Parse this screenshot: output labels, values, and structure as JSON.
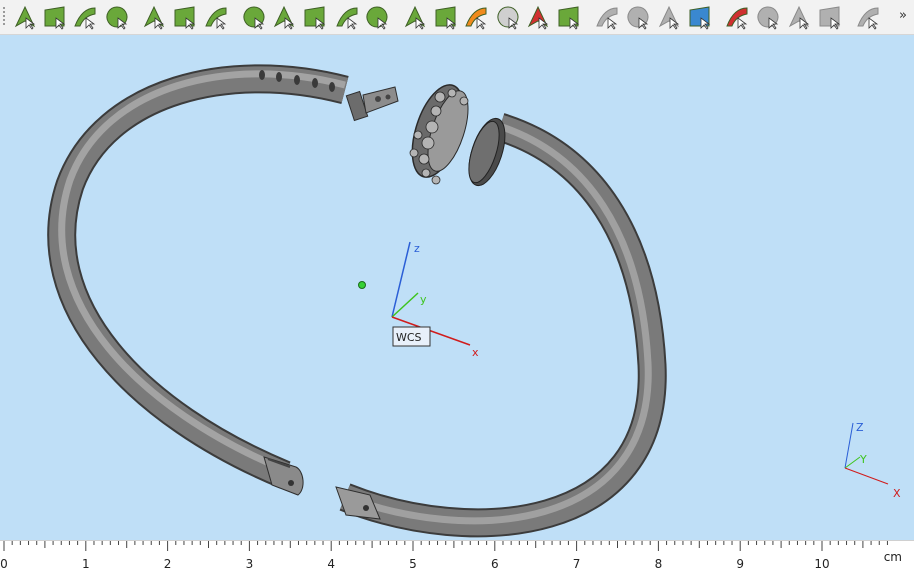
{
  "toolbar": {
    "buttons": [
      {
        "name": "select-vertex-icon",
        "color": "#6aa83a"
      },
      {
        "name": "select-edge-icon",
        "color": "#6aa83a"
      },
      {
        "name": "select-curve-icon",
        "color": "#6aa83a"
      },
      {
        "name": "select-circle-icon",
        "color": "#6aa83a"
      },
      {
        "name": "select-face-icon",
        "color": "#6aa83a"
      },
      {
        "name": "select-surface-icon",
        "color": "#6aa83a"
      },
      {
        "name": "select-spline-icon",
        "color": "#6aa83a"
      },
      {
        "name": "select-mesh-icon",
        "color": "#6aa83a"
      },
      {
        "name": "select-patch-icon",
        "color": "#6aa83a"
      },
      {
        "name": "select-cross-icon",
        "color": "#6aa83a"
      },
      {
        "name": "select-sphere-icon",
        "color": "#6aa83a"
      },
      {
        "name": "select-revolve-icon",
        "color": "#6aa83a"
      },
      {
        "name": "select-body-icon",
        "color": "#6aa83a"
      },
      {
        "name": "select-solid-icon",
        "color": "#6aa83a"
      },
      {
        "name": "select-part-icon",
        "color": "#f08a1c"
      },
      {
        "name": "select-shell-icon",
        "color": "#cfcfcf"
      },
      {
        "name": "select-component-icon",
        "color": "#d03030"
      },
      {
        "name": "select-assembly-icon",
        "color": "#6aa83a"
      },
      {
        "name": "pointer-icon",
        "color": "#b0b0b0"
      },
      {
        "name": "pointer-filter-icon",
        "color": "#b0b0b0"
      },
      {
        "name": "pointer-multi-icon",
        "color": "#b0b0b0"
      },
      {
        "name": "pointer-blue-icon",
        "color": "#3a88d0"
      },
      {
        "name": "pointer-clear-icon",
        "color": "#d03030"
      },
      {
        "name": "cutter-icon",
        "color": "#b0b0b0"
      },
      {
        "name": "cutter-copy-icon",
        "color": "#b0b0b0"
      },
      {
        "name": "cutter-paste-icon",
        "color": "#b0b0b0"
      },
      {
        "name": "eye-pointer-icon",
        "color": "#b0b0b0"
      }
    ],
    "more_label": "»"
  },
  "viewport": {
    "background": "#bfdff7",
    "model_color": "#7a7a7a",
    "wcs_label": "WCS",
    "wcs_axes": {
      "x": "x",
      "y": "y",
      "z": "z"
    },
    "corner_axes": {
      "x": "X",
      "y": "Y",
      "z": "Z"
    },
    "axis_colors": {
      "x": "#d01c1c",
      "y": "#3ec41e",
      "z": "#2a5ed6"
    }
  },
  "ruler": {
    "numbers": [
      "0",
      "1",
      "2",
      "3",
      "4",
      "5",
      "6",
      "7",
      "8",
      "9",
      "10"
    ],
    "unit": "cm"
  }
}
